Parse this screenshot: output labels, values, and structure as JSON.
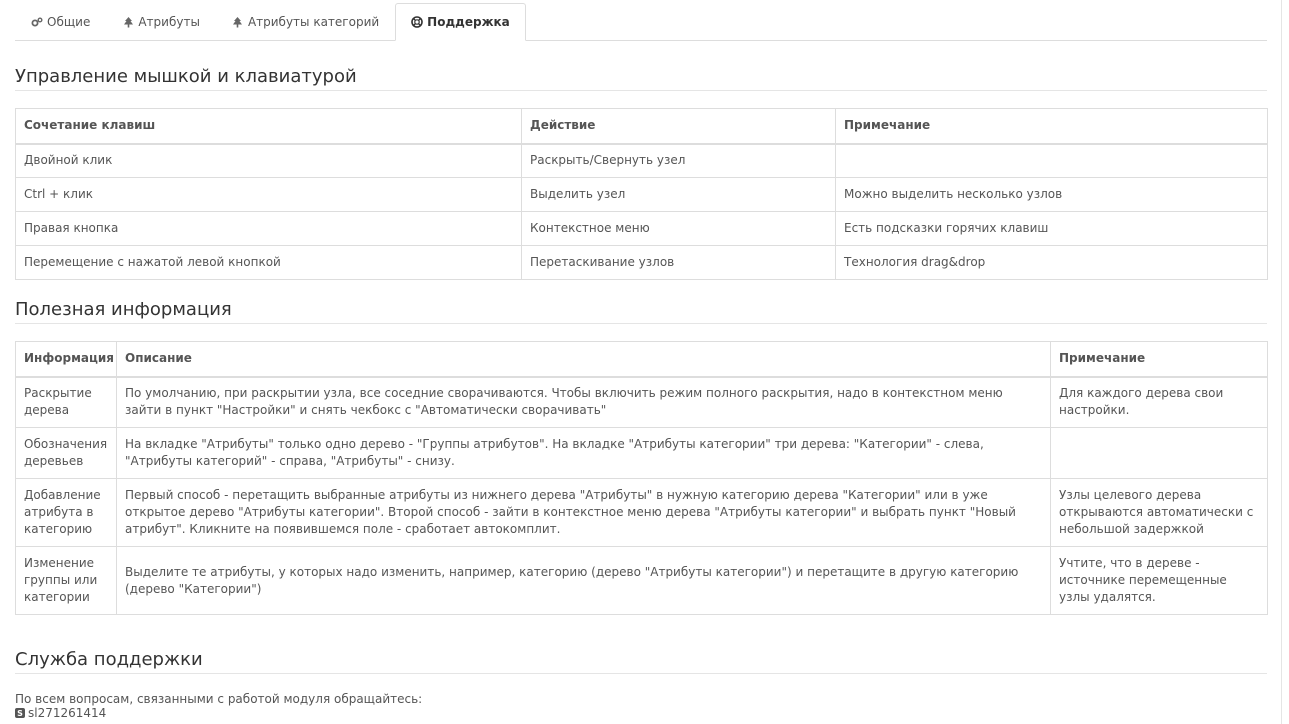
{
  "tabs": [
    {
      "label": "Общие",
      "icon": "gears-icon"
    },
    {
      "label": "Атрибуты",
      "icon": "tree-icon"
    },
    {
      "label": "Атрибуты категорий",
      "icon": "tree-icon"
    },
    {
      "label": "Поддержка",
      "icon": "lifebuoy-icon",
      "active": true
    }
  ],
  "keyboard_section": {
    "title": "Управление мышкой и клавиатурой",
    "headers": [
      "Сочетание клавиш",
      "Действие",
      "Примечание"
    ],
    "rows": [
      [
        "Двойной клик",
        "Раскрыть/Свернуть узел",
        ""
      ],
      [
        "Ctrl + клик",
        "Выделить узел",
        "Можно выделить несколько узлов"
      ],
      [
        "Правая кнопка",
        "Контекстное меню",
        "Есть подсказки горячих клавиш"
      ],
      [
        "Перемещение с нажатой левой кнопкой",
        "Перетаскивание узлов",
        "Технология drag&drop"
      ]
    ]
  },
  "info_section": {
    "title": "Полезная информация",
    "headers": [
      "Информация",
      "Описание",
      "Примечание"
    ],
    "rows": [
      [
        "Раскрытие дерева",
        "По умолчанию, при раскрытии узла, все соседние сворачиваются. Чтобы включить режим полного раскрытия, надо в контекстном меню зайти в пункт \"Настройки\" и снять чекбокс с \"Автоматически сворачивать\"",
        "Для каждого дерева свои настройки."
      ],
      [
        "Обозначения деревьев",
        "На вкладке \"Атрибуты\" только одно дерево - \"Группы атрибутов\". На вкладке \"Атрибуты категории\" три дерева: \"Категории\" - слева, \"Атрибуты категорий\" - справа, \"Атрибуты\" - снизу.",
        ""
      ],
      [
        "Добавление атрибута в категорию",
        "Первый способ - перетащить выбранные атрибуты из нижнего дерева \"Атрибуты\" в нужную категорию дерева \"Категории\" или в уже открытое дерево \"Атрибуты категории\". Второй способ - зайти в контекстное меню дерева \"Атрибуты категории\" и выбрать пункт \"Новый атрибут\". Кликните на появившемся поле - сработает автокомплит.",
        "Узлы целевого дерева открываются автоматически с небольшой задержкой"
      ],
      [
        "Изменение группы или категории",
        "Выделите те атрибуты, у которых надо изменить, например, категорию (дерево \"Атрибуты категории\") и перетащите в другую категорию (дерево \"Категории\")",
        "Учтите, что в дереве - источнике перемещенные узлы удалятся."
      ]
    ]
  },
  "support_section": {
    "title": "Служба поддержки",
    "text": "По всем вопросам, связанными с работой модуля обращайтесь:",
    "skype_icon": "skype-icon",
    "skype_id": "sl271261414"
  },
  "colors": {
    "border": "#dddddd",
    "text": "#555555",
    "heading": "#333333"
  }
}
